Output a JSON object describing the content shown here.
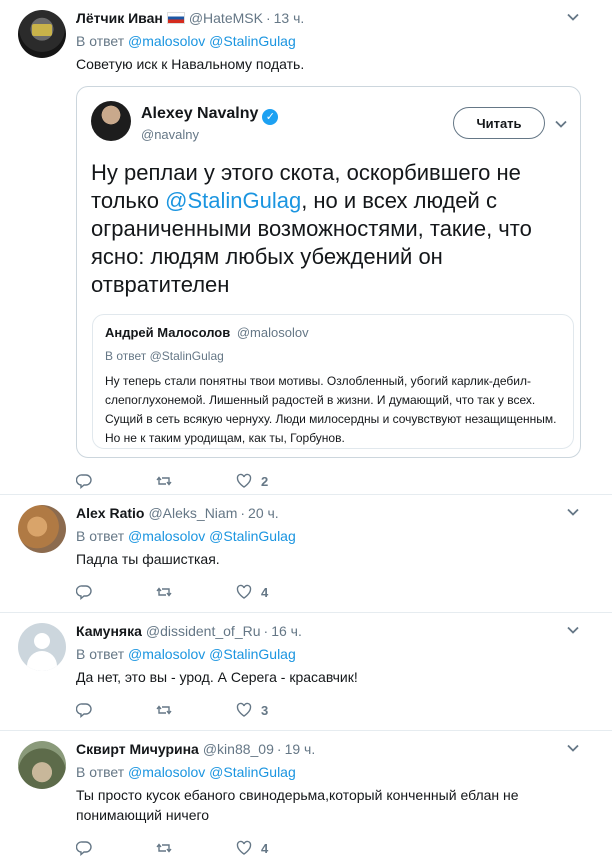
{
  "tweets": [
    {
      "name": "Лётчик Иван",
      "handle": "@HateMSK",
      "time": "13 ч.",
      "reply_label": "В ответ",
      "reply_mentions": "@malosolov @StalinGulag",
      "text": "Советую иск к Навальному подать.",
      "replies_count": "",
      "retweets_count": "",
      "likes_count": "2"
    },
    {
      "name": "Alex Ratio",
      "handle": "@Aleks_Niam",
      "time": "20 ч.",
      "reply_label": "В ответ",
      "reply_mentions": "@malosolov @StalinGulag",
      "text": "Падла ты фашисткая.",
      "likes_count": "4"
    },
    {
      "name": "Камуняка",
      "handle": "@dissident_of_Ru",
      "time": "16 ч.",
      "reply_label": "В ответ",
      "reply_mentions": "@malosolov @StalinGulag",
      "text": "Да нет, это вы - урод. А Серега - красавчик!",
      "likes_count": "3"
    },
    {
      "name": "Сквирт Мичурина",
      "handle": "@kin88_09",
      "time": "19 ч.",
      "reply_label": "В ответ",
      "reply_mentions": "@malosolov @StalinGulag",
      "text": "Ты просто кусок ебаного свинодерьма,который конченный еблан не понимающий ничего",
      "likes_count": "4"
    }
  ],
  "quote": {
    "name": "Alexey Navalny",
    "handle": "@navalny",
    "follow_label": "Читать",
    "text_before": "Ну реплаи у этого скота, оскорбившего не только ",
    "text_mention": "@StalinGulag",
    "text_after": ", но и всех людей с ограниченными возможностями, такие, что ясно: людям любых убеждений он отвратителен",
    "nested": {
      "name": "Андрей Малосолов",
      "handle": "@malosolov",
      "reply_label": "В ответ @StalinGulag",
      "text": "Ну теперь стали понятны твои мотивы. Озлобленный, убогий карлик-дебил-слепоглухонемой. Лишенный радостей в жизни. И думающий, что так у всех. Сущий в сеть всякую чернуху. Люди милосердны и сочувствуют незащищенным. Но не к таким уродищам, как ты, Горбунов."
    }
  },
  "separator": "·",
  "icons": {
    "reply": "reply-icon",
    "retweet": "retweet-icon",
    "like": "heart-icon",
    "caret": "chevron-down-icon",
    "verified": "verified-icon",
    "flag": "russia-flag-icon"
  },
  "colors": {
    "link": "#1b95e0",
    "muted": "#657786",
    "verified": "#1da1f2",
    "border": "#e6ecf0"
  }
}
